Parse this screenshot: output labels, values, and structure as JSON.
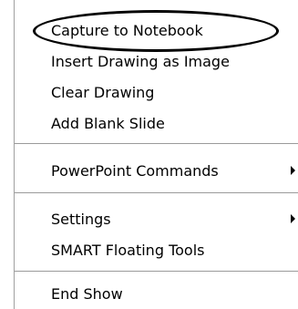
{
  "menu": {
    "items": [
      {
        "label": "Capture to Notebook",
        "submenu": false,
        "highlighted": true
      },
      {
        "label": "Insert Drawing as Image",
        "submenu": false
      },
      {
        "label": "Clear Drawing",
        "submenu": false
      },
      {
        "label": "Add Blank Slide",
        "submenu": false
      },
      {
        "label": "PowerPoint Commands",
        "submenu": true
      },
      {
        "label": "Settings",
        "submenu": true
      },
      {
        "label": "SMART Floating Tools",
        "submenu": false
      },
      {
        "label": "End Show",
        "submenu": false
      }
    ]
  },
  "colors": {
    "background": "#ffffff",
    "text": "#000000",
    "separator": "#9a9a9a",
    "highlight_outline": "#000000"
  }
}
